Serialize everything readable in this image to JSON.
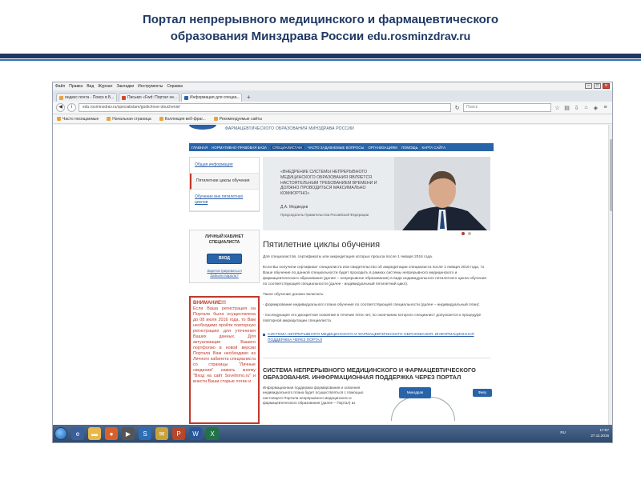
{
  "slide": {
    "title_line1": "Портал непрерывного медицинского и фармацевтического",
    "title_line2": "образования Минздрава России",
    "title_url": "edu.rosminzdrav.ru"
  },
  "browser": {
    "menu": [
      "Файл",
      "Правка",
      "Вид",
      "Журнал",
      "Закладки",
      "Инструменты",
      "Справка"
    ],
    "window_controls": [
      "–",
      "□",
      "✕"
    ],
    "tabs": [
      {
        "label": "яндекс почта - Поиск в Б...",
        "color": "#e8a33d"
      },
      {
        "label": "Письмо «Fwd: Портал не...",
        "color": "#d04a2c"
      },
      {
        "label": "Информация для специа...",
        "color": "#2a64a8"
      }
    ],
    "new_tab": "+",
    "url": "edu.rosminzdrav.ru/specialistam/godichnoe-obuchenie/",
    "search_placeholder": "Поиск",
    "bookmarks": [
      "Часто посещаемые",
      "Начальная страница",
      "Коллекция веб-фраг...",
      "Рекомендуемые сайты"
    ],
    "status_url": "https://sovet.edu.rosminzdrav.ru/login.jsp"
  },
  "site": {
    "header_text": "ФАРМАЦЕВТИЧЕСКОГО ОБРАЗОВАНИЯ МИНЗДРАВА РОССИИ",
    "nav": [
      "ГЛАВНАЯ",
      "НОРМАТИВНО-ПРАВОВАЯ БАЗА",
      "СПЕЦИАЛИСТАМ",
      "ЧАСТО ЗАДАВАЕМЫЕ ВОПРОСЫ",
      "ОРГАНИЗАЦИЯМ",
      "ПОМОЩЬ",
      "КАРТА САЙТА"
    ],
    "left_menu": [
      "Общая информация",
      "Пятилетние циклы обучения",
      "Обучение вне пятилетних циклов"
    ],
    "cabinet": {
      "title": "ЛИЧНЫЙ КАБИНЕТ СПЕЦИАЛИСТА",
      "login": "ВХОД",
      "register": "Зарегистрироваться",
      "forgot": "Забыли пароль?"
    },
    "warning": {
      "title": "ВНИМАНИЕ!!!",
      "text": "Если Ваша регистрация на Портале была осуществлена до 08 июля 2016 года, то Вам необходимо пройти повторную регистрацию для уточнения Ваших данных. Для актуализации Вашего портфолио в новой версии Портала Вам необходимо из Личного кабинета специалиста со страницы \"Личные сведения\" нажать кнопку \"Вход на сайт Sovetnmo.ru\" и внести Ваши старые логин и"
    },
    "banner": {
      "quote": "«ВНЕДРЕНИЕ СИСТЕМЫ НЕПРЕРЫВНОГО МЕДИЦИНСКОГО ОБРАЗОВАНИЯ ЯВЛЯЕТСЯ НАСТОЯТЕЛЬНЫМ ТРЕБОВАНИЕМ ВРЕМЕНИ И ДОЛЖНО ПРОВОДИТЬСЯ МАКСИМАЛЬНО КОМФОРТНО»",
      "author": "Д.А. Медведев",
      "role": "Председатель Правительства Российской Федерации"
    },
    "heading": "Пятилетние циклы обучения",
    "p1": "Для специалистов, сертификаты или аккредитация которых прошла после 1 января 2016 года.",
    "p2": "Если Вы получили сертификат специалиста или свидетельство об аккредитации специалиста после 1 января 2016 года, то Ваше обучение по данной специальности будет проходить в рамках системы непрерывного медицинского и фармацевтического образования (далее – непрерывное образование) в виде индивидуального пятилетнего цикла обучения по соответствующей специальности (далее - индивидуальный пятилетний цикл).",
    "p3": "Такое обучение должно включать:",
    "p4": "- формирование индивидуального плана обучения по соответствующей специальности (далее – индивидуальный план);",
    "p5": "- последующее его дискретное освоение в течение пяти лет, по окончанию которого специалист допускается к процедуре повторной аккредитации специалиста.",
    "link": "СИСТЕМА НЕПРЕРЫВНОГО МЕДИЦИНСКОГО И ФАРМАЦЕВТИЧЕСКОГО ОБРАЗОВАНИЯ. ИНФОРМАЦИОННАЯ ПОДДЕРЖКА ЧЕРЕЗ ПОРТАЛ",
    "h2": "СИСТЕМА НЕПРЕРЫВНОГО МЕДИЦИНСКОГО И ФАРМАЦЕВТИЧЕСКОГО ОБРАЗОВАНИЯ. ИНФОРМАЦИОННАЯ ПОДДЕРЖКА ЧЕРЕЗ ПОРТАЛ",
    "lower_text": "Информационная поддержка формирования и освоения индивидуального плана будет осуществляться с помощью настоящего Портала непрерывного медицинского и фармацевтического образования (далее – Портал) из",
    "diagram_box": "Минздрав",
    "diagram_box2": "Фмпу"
  },
  "taskbar": {
    "lang": "RU",
    "time": "17:57",
    "date": "27.11.2016"
  },
  "colors": {
    "slide_title": "#1f3864",
    "site_nav": "#2a64a8",
    "warning": "#c0392b"
  }
}
